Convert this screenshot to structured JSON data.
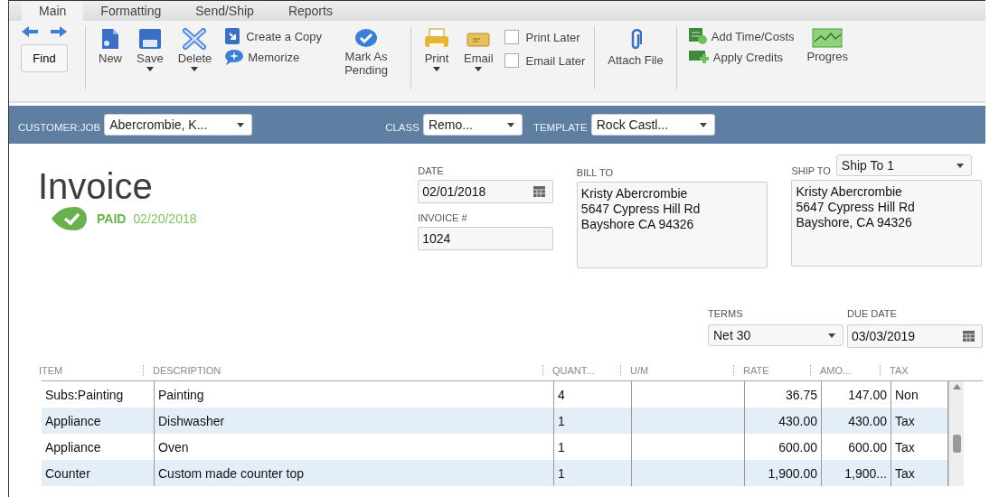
{
  "tabs": [
    {
      "label": "Main",
      "selected": true
    },
    {
      "label": "Formatting",
      "selected": false
    },
    {
      "label": "Send/Ship",
      "selected": false
    },
    {
      "label": "Reports",
      "selected": false
    }
  ],
  "toolbar": {
    "find": "Find",
    "new": {
      "label": "New"
    },
    "save": {
      "label": "Save",
      "has_menu": true
    },
    "delete": {
      "label": "Delete",
      "has_menu": true
    },
    "create_copy": "Create a Copy",
    "memorize": "Memorize",
    "mark_as_pending": "Mark As Pending",
    "print": {
      "label": "Print",
      "has_menu": true
    },
    "email": {
      "label": "Email",
      "has_menu": true
    },
    "checkboxes": [
      {
        "label": "Print Later",
        "checked": false
      },
      {
        "label": "Email Later",
        "checked": false
      }
    ],
    "attach_file": "Attach File",
    "add_time_costs": "Add Time/Costs",
    "apply_credits": "Apply Credits",
    "progress": "Progres"
  },
  "header_bar": {
    "customer_job": {
      "label": "CUSTOMER:JOB",
      "value": "Abercrombie, K..."
    },
    "class": {
      "label": "CLASS",
      "value": "Remo..."
    },
    "template": {
      "label": "TEMPLATE",
      "value": "Rock Castl..."
    }
  },
  "invoice": {
    "title": "Invoice",
    "status": "PAID",
    "status_date": "02/20/2018",
    "date_label": "DATE",
    "date": "02/01/2018",
    "number_label": "INVOICE #",
    "number": "1024",
    "bill_to_label": "BILL TO",
    "bill_to": [
      "Kristy Abercrombie",
      "5647 Cypress Hill Rd",
      "Bayshore CA 94326"
    ],
    "ship_to_label": "SHIP TO",
    "ship_to_choice": "Ship To 1",
    "ship_to": [
      "Kristy Abercrombie",
      "5647 Cypress Hill Rd",
      "Bayshore, CA 94326"
    ],
    "terms_label": "TERMS",
    "terms": "Net 30",
    "due_date_label": "DUE DATE",
    "due_date": "03/03/2019"
  },
  "table": {
    "columns": [
      "ITEM",
      "DESCRIPTION",
      "QUANT...",
      "U/M",
      "RATE",
      "AMO...",
      "TAX"
    ],
    "rows": [
      {
        "cells": [
          "Subs:Painting",
          "Painting",
          "4",
          "",
          "36.75",
          "147.00",
          "Non"
        ]
      },
      {
        "cells": [
          "Appliance",
          "Dishwasher",
          "1",
          "",
          "430.00",
          "430.00",
          "Tax"
        ]
      },
      {
        "cells": [
          "Appliance",
          "Oven",
          "1",
          "",
          "600.00",
          "600.00",
          "Tax"
        ]
      },
      {
        "cells": [
          "Counter",
          "Custom made counter top",
          "1",
          "",
          "1,900.00",
          "1,900...",
          "Tax"
        ]
      }
    ]
  }
}
